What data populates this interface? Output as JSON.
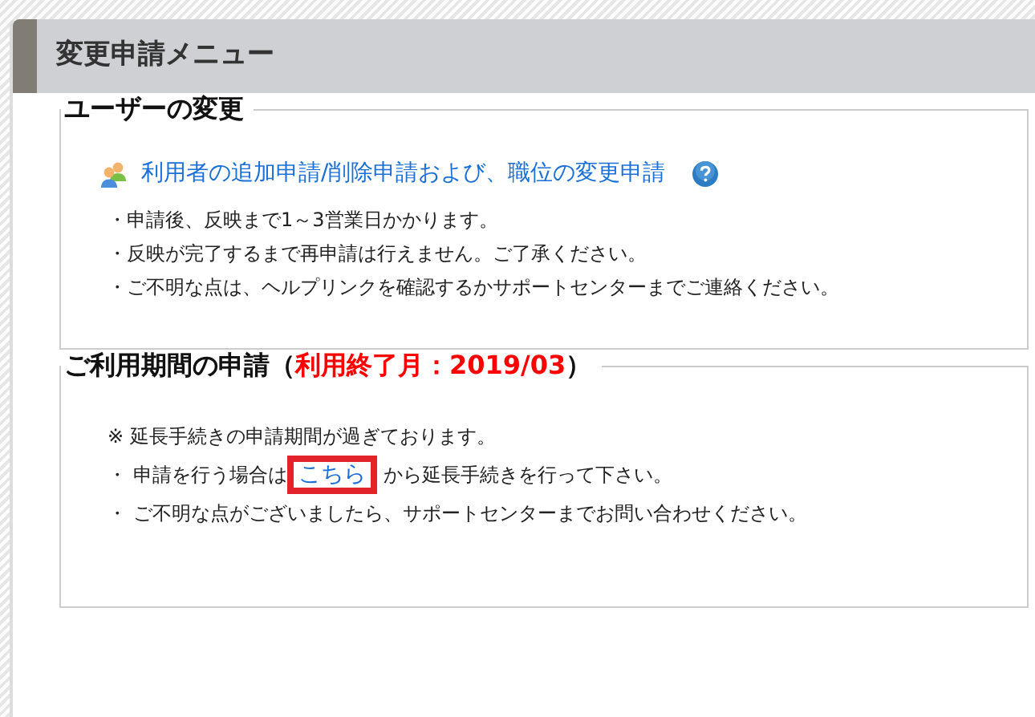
{
  "panel": {
    "title": "変更申請メニュー"
  },
  "sections": [
    {
      "title_parts": [
        {
          "text": "ユーザーの変更",
          "kind": "plain"
        }
      ],
      "link": {
        "text": "利用者の追加申請/削除申請および、職位の変更申請",
        "help": true
      },
      "lines": [
        {
          "kind": "plain",
          "text": "・申請後、反映まで1～3営業日かかります。"
        },
        {
          "kind": "plain",
          "text": "・反映が完了するまで再申請は行えません。ご了承ください。"
        },
        {
          "kind": "plain",
          "text": "・ご不明な点は、ヘルプリンクを確認するかサポートセンターまでご連絡ください。"
        }
      ]
    },
    {
      "title_parts": [
        {
          "text": "ご利用期間の申請（",
          "kind": "plain"
        },
        {
          "text": "利用終了月：2019/03",
          "kind": "alert"
        },
        {
          "text": "）",
          "kind": "plain"
        }
      ],
      "lines": [
        {
          "kind": "plain",
          "text": "※ 延長手続きの申請期間が過ぎております。"
        },
        {
          "kind": "link",
          "before": "・ 申請を行う場合は",
          "link": "こちら",
          "after": "から延長手続きを行って下さい。",
          "highlighted": true
        },
        {
          "kind": "plain",
          "text": "・ ご不明な点がございましたら、サポートセンターまでお問い合わせください。"
        }
      ]
    }
  ]
}
